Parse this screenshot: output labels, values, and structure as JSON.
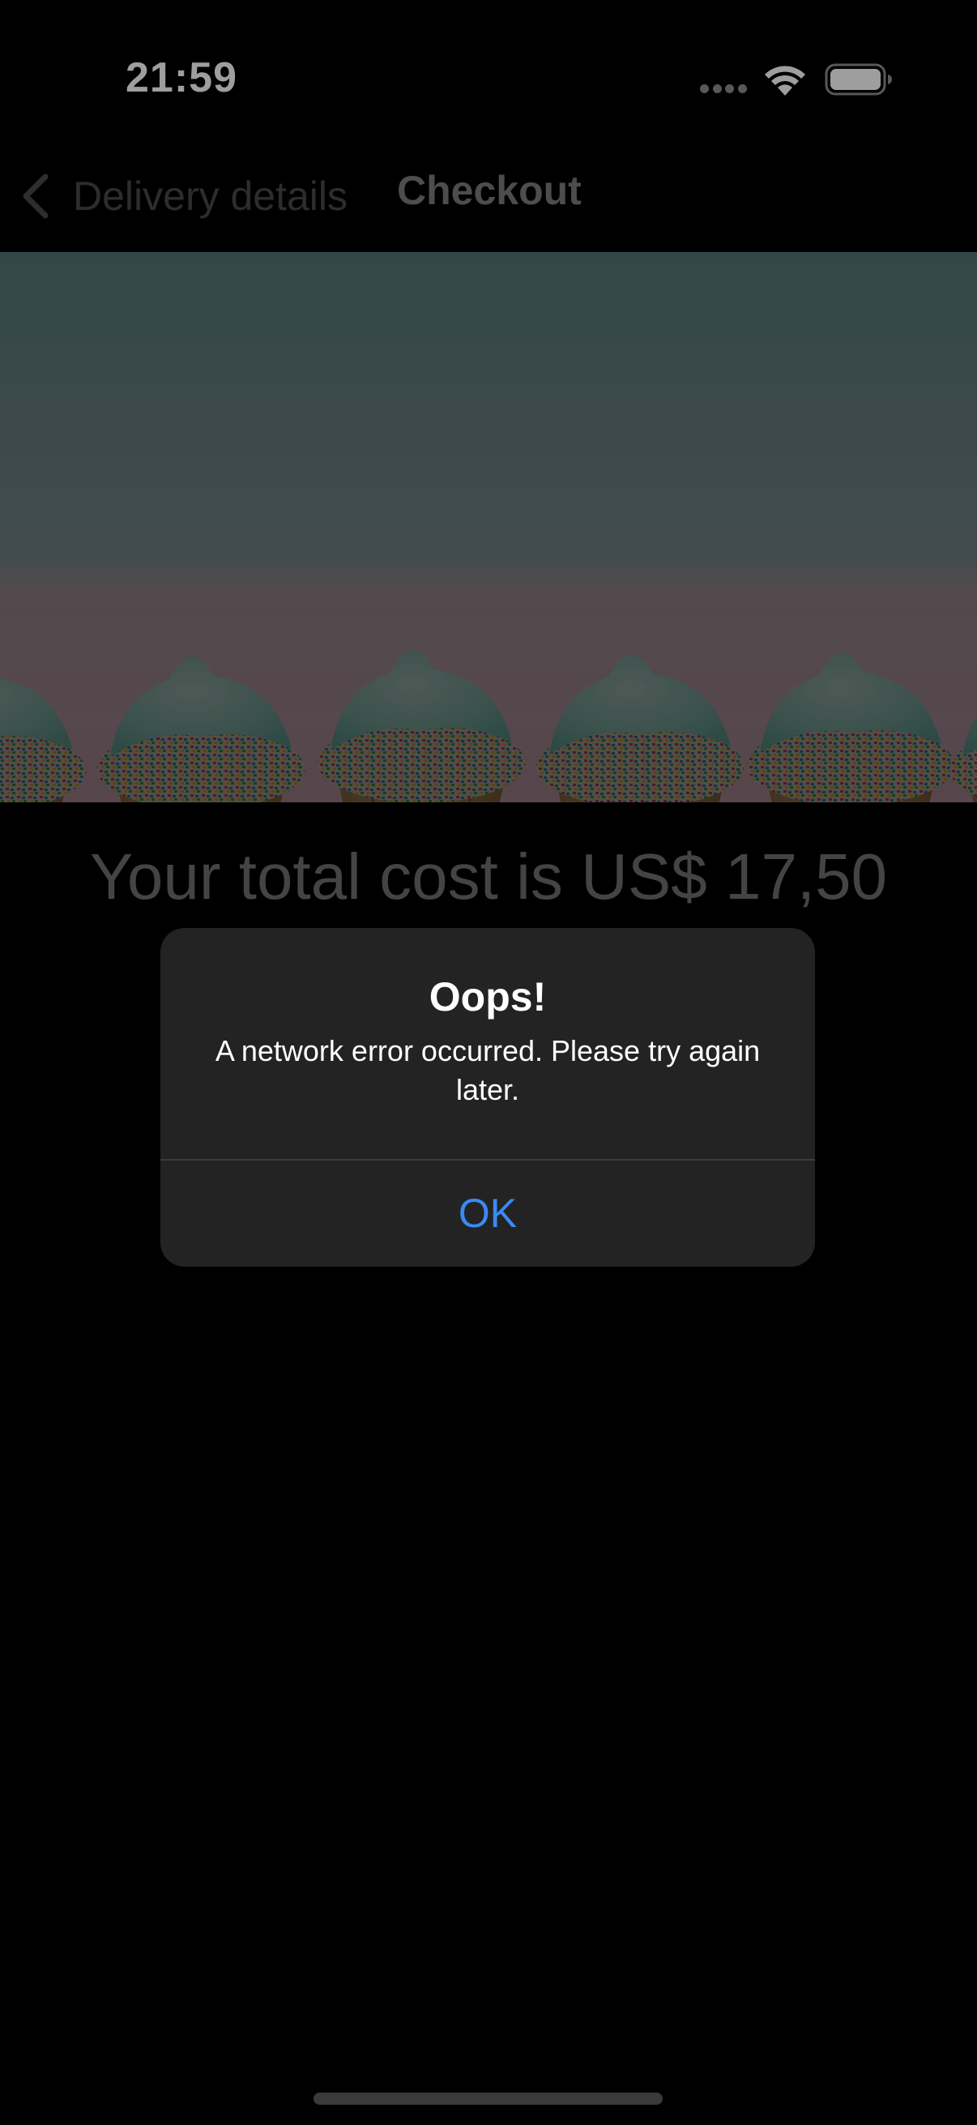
{
  "status_bar": {
    "time": "21:59"
  },
  "nav": {
    "back_label": "Delivery details",
    "title": "Checkout"
  },
  "hero": {
    "image_subject": "cupcakes with mint frosting and sprinkles"
  },
  "checkout": {
    "total_text": "Your total cost is US$ 17,50"
  },
  "alert": {
    "title": "Oops!",
    "message": "A network error occurred. Please try again later.",
    "ok_label": "OK"
  },
  "colors": {
    "accent": "#3a8af5",
    "alert_background": "#232323",
    "background": "#000000"
  }
}
